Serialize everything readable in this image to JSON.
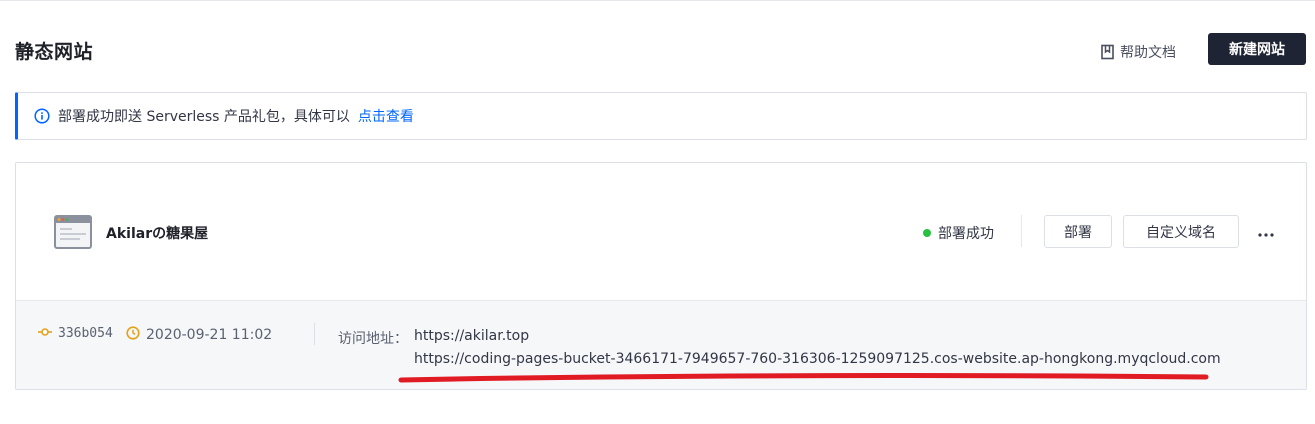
{
  "header": {
    "title": "静态网站",
    "help_label": "帮助文档",
    "new_site_label": "新建网站"
  },
  "notice": {
    "text": "部署成功即送 Serverless 产品礼包，具体可以",
    "link_label": "点击查看"
  },
  "site": {
    "name": "Akilarの糖果屋",
    "status": "部署成功",
    "deploy_label": "部署",
    "custom_domain_label": "自定义域名",
    "commit": "336b054",
    "deployed_at": "2020-09-21 11:02",
    "url_label": "访问地址：",
    "urls": [
      "https://akilar.top",
      "https://coding-pages-bucket-3466171-7949657-760-316306-1259097125.cos-website.ap-hongkong.myqcloud.com"
    ]
  },
  "colors": {
    "primary_dark": "#1e2433",
    "link_blue": "#0066ff",
    "success_green": "#26c140",
    "commit_orange": "#e3a21a",
    "annotation_red": "#e01b24"
  },
  "icons": {
    "help": "book-icon",
    "info": "info-circle-icon",
    "site": "browser-window-icon",
    "commit": "git-commit-icon",
    "time": "clock-icon",
    "more": "more-horizontal-icon"
  }
}
